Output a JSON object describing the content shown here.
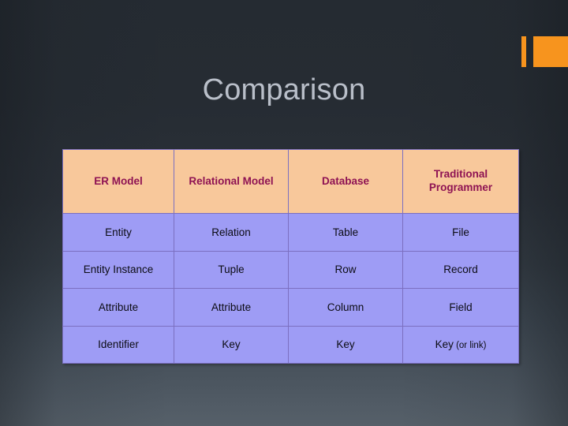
{
  "slide": {
    "title": "Comparison",
    "background_top_color": "#262c33",
    "background_bottom_color": "#566069",
    "accent_color": "#f7941e",
    "title_color": "#b9bfc9"
  },
  "decorations": {
    "bar_thin_name": "orange-accent-bar-thin",
    "bar_block_name": "orange-accent-bar-block"
  },
  "table": {
    "header_bg": "#f8c89b",
    "header_text_color": "#8e1253",
    "body_bg": "#9e9cf5",
    "body_text_color": "#0c0c14",
    "border_color": "#7b6fc0",
    "headers": [
      "ER Model",
      "Relational Model",
      "Database",
      "Traditional Programmer"
    ],
    "rows": [
      {
        "er_model": "Entity",
        "relational_model": "Relation",
        "database": "Table",
        "traditional_programmer": "File"
      },
      {
        "er_model": "Entity Instance",
        "relational_model": "Tuple",
        "database": "Row",
        "traditional_programmer": "Record"
      },
      {
        "er_model": "Attribute",
        "relational_model": "Attribute",
        "database": "Column",
        "traditional_programmer": "Field"
      },
      {
        "er_model": "Identifier",
        "relational_model": "Key",
        "database": "Key",
        "traditional_programmer_main": "Key",
        "traditional_programmer_sub": "(or link)"
      }
    ]
  }
}
